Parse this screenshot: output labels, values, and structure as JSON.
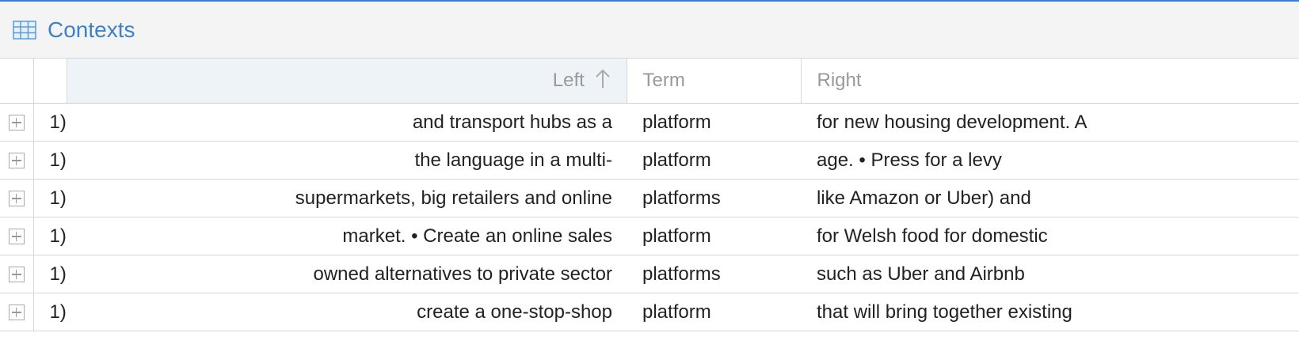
{
  "panel": {
    "title": "Contexts",
    "icon": "table-grid-icon",
    "accent_color": "#3b82c8"
  },
  "columns": {
    "left": "Left",
    "term": "Term",
    "right": "Right",
    "sort_icon": "sort-ascending-arrow-icon"
  },
  "rows": [
    {
      "num": "1)",
      "left": "and transport hubs as a",
      "term": "platform",
      "right": "for new housing development. A"
    },
    {
      "num": "1)",
      "left": "the language in a multi-",
      "term": "platform",
      "right": "age. • Press for a levy"
    },
    {
      "num": "1)",
      "left": "supermarkets, big retailers and online",
      "term": "platforms",
      "right": "like Amazon or Uber) and"
    },
    {
      "num": "1)",
      "left": "market. • Create an online sales",
      "term": "platform",
      "right": "for Welsh food for domestic"
    },
    {
      "num": "1)",
      "left": "owned alternatives to private sector",
      "term": "platforms",
      "right": "such as Uber and Airbnb"
    },
    {
      "num": "1)",
      "left": "create a one-stop-shop",
      "term": "platform",
      "right": "that will bring together existing"
    }
  ]
}
